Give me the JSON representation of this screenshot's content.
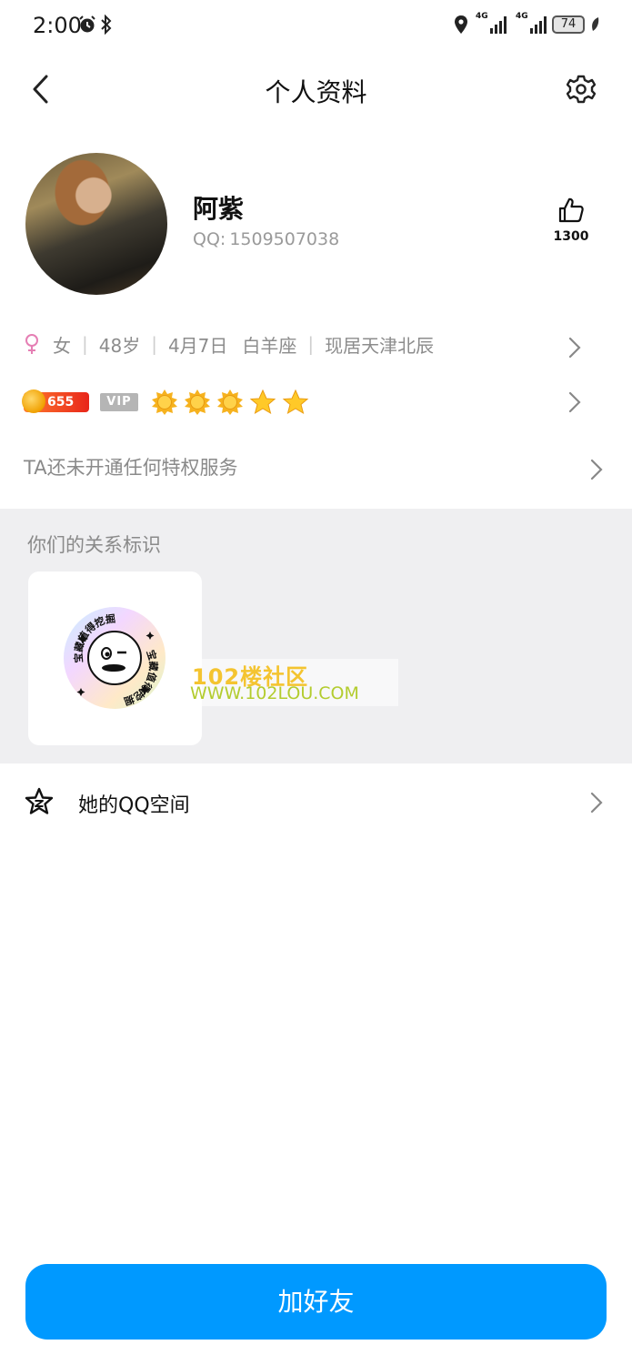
{
  "status_bar": {
    "time": "2:00",
    "network_1": "4G",
    "network_2": "4G",
    "battery": "74"
  },
  "nav": {
    "title": "个人资料"
  },
  "profile": {
    "nickname": "阿紫",
    "qq_label": "QQ:",
    "qq_number": "1509507038",
    "like_count": "1300"
  },
  "info": {
    "gender": "女",
    "age": "48岁",
    "birthday": "4月7日",
    "zodiac": "白羊座",
    "location": "现居天津北辰"
  },
  "badges": {
    "level": "655",
    "vip": "VIP",
    "level_icons": [
      "sun",
      "sun",
      "sun",
      "star",
      "star"
    ]
  },
  "privilege": {
    "text": "TA还未开通任何特权服务"
  },
  "relation": {
    "title": "你们的关系标识",
    "seal_text": "宝藏值得挖掘"
  },
  "watermark": {
    "title": "102楼社区",
    "url": "WWW.102LOU.COM"
  },
  "qzone": {
    "label": "她的QQ空间"
  },
  "action": {
    "add_friend": "加好友"
  },
  "colors": {
    "accent": "#0099ff",
    "female": "#e57fb4"
  }
}
